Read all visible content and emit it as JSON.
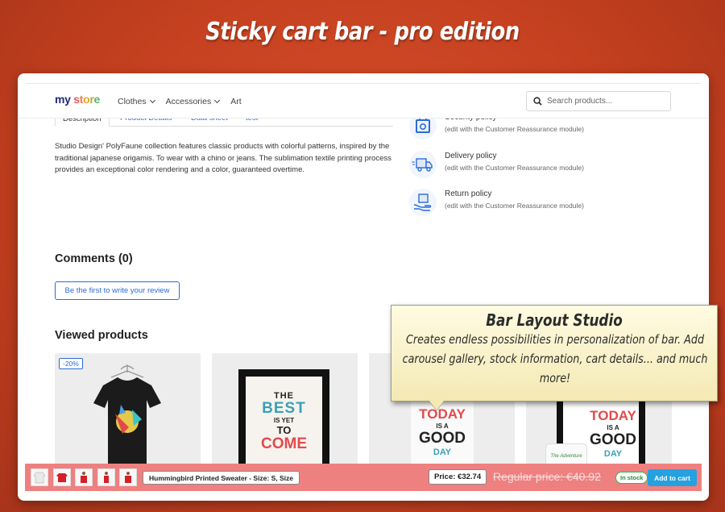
{
  "banner": {
    "title": "Sticky cart bar - pro edition"
  },
  "header": {
    "logo_my": "my",
    "logo_store": "store",
    "nav": [
      "Clothes",
      "Accessories",
      "Art"
    ],
    "search_placeholder": "Search products..."
  },
  "tabs": [
    "Description",
    "Product Details",
    "Data sheet",
    "test"
  ],
  "description": "Studio Design' PolyFaune collection features classic products with colorful patterns, inspired by the traditional japanese origamis. To wear with a chino or jeans. The sublimation textile printing process provides an exceptional color rendering and a color, guaranteed overtime.",
  "reassurance": [
    {
      "title": "Security policy",
      "sub": "(edit with the Customer Reassurance module)",
      "icon": "shield-icon"
    },
    {
      "title": "Delivery policy",
      "sub": "(edit with the Customer Reassurance module)",
      "icon": "truck-icon"
    },
    {
      "title": "Return policy",
      "sub": "(edit with the Customer Reassurance module)",
      "icon": "return-box-icon"
    }
  ],
  "comments": {
    "title": "Comments (0)",
    "button": "Be the first to write your review"
  },
  "viewed": {
    "title": "Viewed products",
    "discount": "-20%",
    "poster1": [
      "THE",
      "BEST",
      "IS YET",
      "TO",
      "COME"
    ],
    "mug": [
      "TODAY",
      "IS A",
      "GOOD",
      "DAY"
    ],
    "poster2": [
      "TODAY",
      "IS A",
      "GOOD",
      "DAY"
    ],
    "mug2": "The Adventure"
  },
  "bubble": {
    "title": "Bar Layout Studio",
    "body": "Creates endless possibilities in personalization of bar. Add carousel gallery, stock information, cart details... and much more!"
  },
  "sticky": {
    "product_name": "Hummingbird Printed Sweater - Size: S, Size",
    "price": "Price: €32.74",
    "regular_price": "Regular price: €40.92",
    "stock": "In stock",
    "add_to_cart": "Add to cart"
  },
  "colors": {
    "bar": "#ef8080",
    "accent": "#2b6cd8",
    "cart_button": "#25a1e0",
    "background": "#c4401f"
  }
}
